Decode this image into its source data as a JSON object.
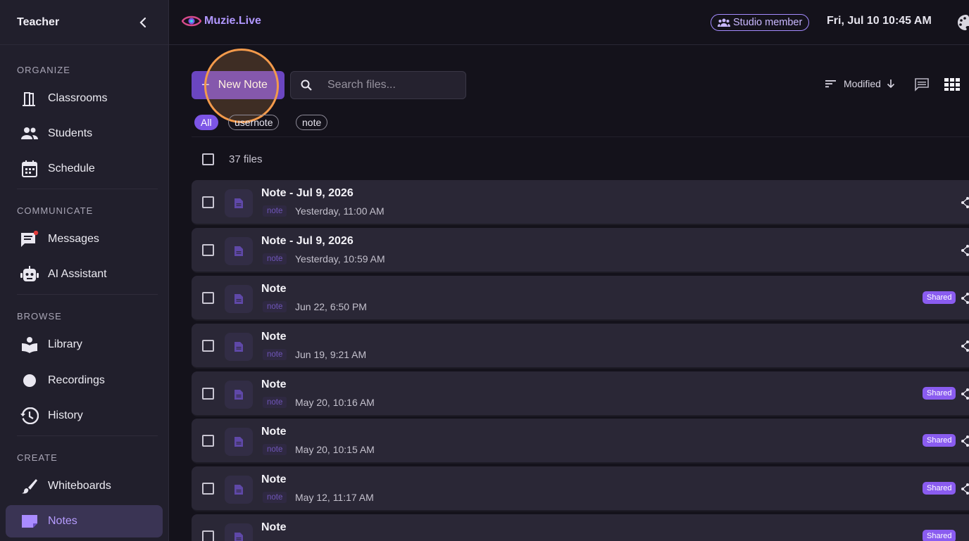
{
  "sidebar": {
    "title": "Teacher",
    "sections": [
      {
        "label": "ORGANIZE",
        "items": [
          {
            "label": "Classrooms",
            "icon": "door-icon"
          },
          {
            "label": "Students",
            "icon": "people-icon"
          },
          {
            "label": "Schedule",
            "icon": "calendar-icon"
          }
        ]
      },
      {
        "label": "COMMUNICATE",
        "items": [
          {
            "label": "Messages",
            "icon": "message-icon"
          },
          {
            "label": "AI Assistant",
            "icon": "robot-icon"
          }
        ]
      },
      {
        "label": "BROWSE",
        "items": [
          {
            "label": "Library",
            "icon": "book-icon"
          },
          {
            "label": "Recordings",
            "icon": "record-icon"
          },
          {
            "label": "History",
            "icon": "history-icon"
          }
        ]
      },
      {
        "label": "CREATE",
        "items": [
          {
            "label": "Whiteboards",
            "icon": "brush-icon"
          },
          {
            "label": "Notes",
            "icon": "note-icon",
            "active": true
          }
        ]
      }
    ]
  },
  "topbar": {
    "brand": "Muzie.Live",
    "membership": "Studio member",
    "datetime": "Fri, Jul 10 10:45 AM"
  },
  "toolbar": {
    "new_note_label": "New Note",
    "search_placeholder": "Search files...",
    "sort_label": "Modified"
  },
  "filters": [
    "All",
    "usernote",
    "note"
  ],
  "file_count": "37 files",
  "files": [
    {
      "name": "Note - Jul 9, 2026",
      "tag": "note",
      "date": "Yesterday, 11:00 AM",
      "shared": ""
    },
    {
      "name": "Note - Jul 9, 2026",
      "tag": "note",
      "date": "Yesterday, 10:59 AM",
      "shared": ""
    },
    {
      "name": "Note",
      "tag": "note",
      "date": "Jun 22, 6:50 PM",
      "shared": "Shared"
    },
    {
      "name": "Note",
      "tag": "note",
      "date": "Jun 19, 9:21 AM",
      "shared": ""
    },
    {
      "name": "Note",
      "tag": "note",
      "date": "May 20, 10:16 AM",
      "shared": "Shared"
    },
    {
      "name": "Note",
      "tag": "note",
      "date": "May 20, 10:15 AM",
      "shared": "Shared"
    },
    {
      "name": "Note",
      "tag": "note",
      "date": "May 12, 11:17 AM",
      "shared": "Shared"
    },
    {
      "name": "Note",
      "tag": "note",
      "date": "",
      "shared": "Shared"
    }
  ],
  "colors": {
    "accent": "#6b46c1",
    "active_text": "#b69cff",
    "shared_badge": "#8a5cf0",
    "highlight": "#f39a4b"
  }
}
